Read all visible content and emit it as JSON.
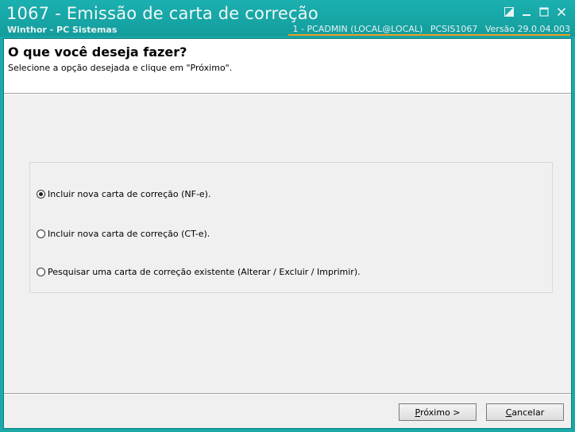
{
  "window": {
    "title": "1067 - Emissão de carta de correção",
    "subtitle": "Winthor - PC Sistemas",
    "session": {
      "user": "1 - PCADMIN (LOCAL@LOCAL)",
      "program": "PCSIS1067",
      "version": "Versão  29.0.04.003"
    },
    "controls": [
      "restore-icon",
      "minimize-icon",
      "maximize-icon",
      "close-icon"
    ]
  },
  "header": {
    "title": "O que você deseja fazer?",
    "instructions": "Selecione a opção desejada e clique em \"Próximo\"."
  },
  "options": [
    {
      "label": "Incluir nova carta de correção (NF-e).",
      "selected": true
    },
    {
      "label": "Incluir nova carta de correção (CT-e).",
      "selected": false
    },
    {
      "label": "Pesquisar uma carta de correção existente (Alterar / Excluir / Imprimir).",
      "selected": false
    }
  ],
  "buttons": {
    "next_accel": "P",
    "next_rest": "róximo >",
    "cancel_accel": "C",
    "cancel_rest": "ancelar"
  },
  "colors": {
    "titlebar": "#17a3a3",
    "accent_underline": "#f0a020"
  }
}
